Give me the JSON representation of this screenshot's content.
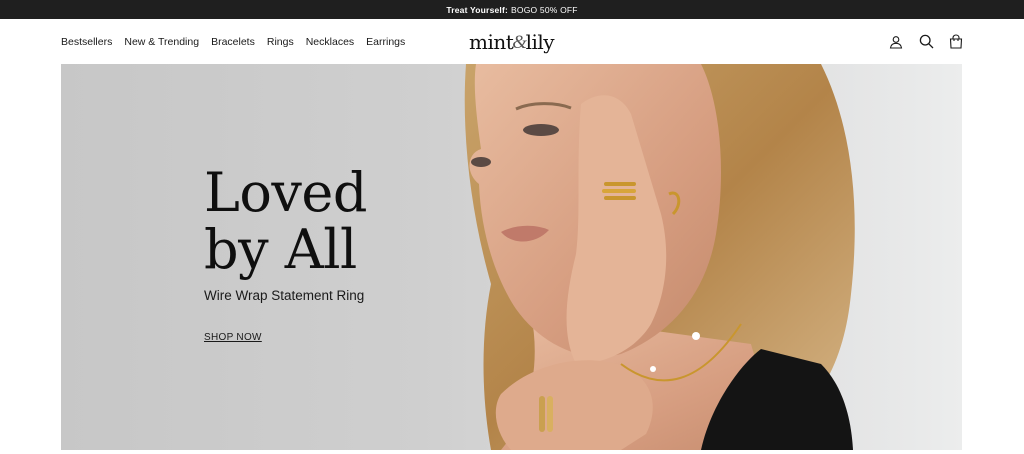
{
  "announcement": {
    "strong": "Treat Yourself:",
    "text": "BOGO 50% OFF"
  },
  "nav": {
    "items": [
      "Bestsellers",
      "New & Trending",
      "Bracelets",
      "Rings",
      "Necklaces",
      "Earrings"
    ]
  },
  "logo": {
    "part1": "mint",
    "amp": "&",
    "part2": "lily"
  },
  "header_icons": [
    "account-icon",
    "search-icon",
    "cart-icon"
  ],
  "hero": {
    "headline_line1": "Loved",
    "headline_line2": "by All",
    "subhead": "Wire Wrap Statement Ring",
    "cta": "SHOP NOW"
  },
  "colors": {
    "announcement_bg": "#1f1f1f",
    "text": "#1a1a1a",
    "hero_bg": "#cfcfcf"
  }
}
